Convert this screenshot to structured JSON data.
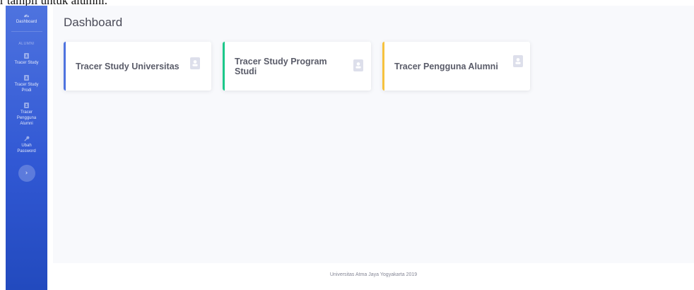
{
  "caption": "r tampil untuk alumni.",
  "sidebar": {
    "brand_label": "Dashboard",
    "section_heading": "ALUMNI",
    "items": [
      {
        "label": "Tracer Study",
        "icon": "id-card-icon"
      },
      {
        "label": "Tracer Study Prodi",
        "icon": "id-card-icon"
      },
      {
        "label": "Tracer Pengguna Alumni",
        "icon": "id-card-icon"
      },
      {
        "label": "Ubah Password",
        "icon": "key-icon"
      }
    ],
    "toggle_icon": "chevron-right-icon"
  },
  "header": {
    "title": "Dashboard"
  },
  "cards": [
    {
      "label": "Tracer Study Universitas",
      "accent": "#4e73df",
      "icon": "id-card-icon"
    },
    {
      "label": "Tracer Study Program Studi",
      "accent": "#1cc88a",
      "icon": "id-card-icon"
    },
    {
      "label": "Tracer Pengguna Alumni",
      "accent": "#f6c23e",
      "icon": "id-card-icon"
    }
  ],
  "footer": {
    "text": "Universitas Atma Jaya Yogyakarta 2019"
  },
  "colors": {
    "sidebar_top": "#4e73df",
    "sidebar_bottom": "#224abe",
    "content_bg": "#f8f9fc",
    "card_icon": "#dddfeb"
  }
}
